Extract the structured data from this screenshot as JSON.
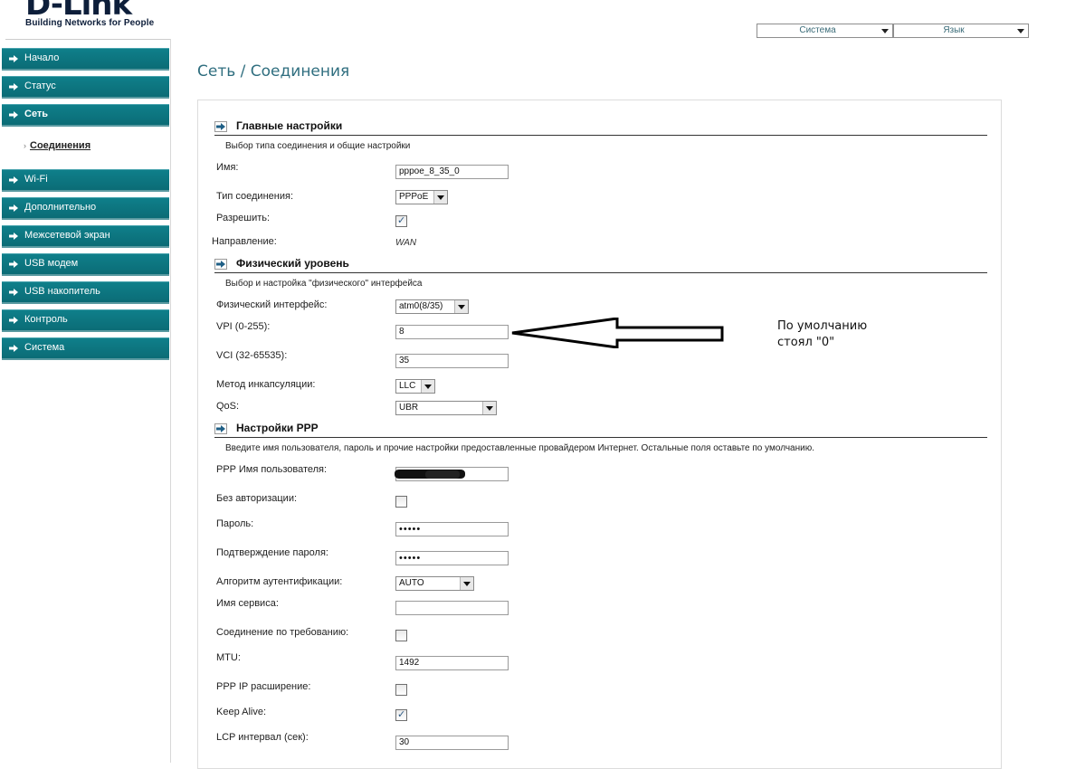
{
  "logo": {
    "name": "D-Link",
    "tagline": "Building Networks for People"
  },
  "top_menu": {
    "system": "Система",
    "language": "Язык"
  },
  "sidebar": {
    "items": [
      {
        "label": "Начало",
        "bold": false
      },
      {
        "label": "Статус",
        "bold": false
      },
      {
        "label": "Сеть",
        "bold": true
      },
      {
        "label": "Wi-Fi",
        "bold": false
      },
      {
        "label": "Дополнительно",
        "bold": false
      },
      {
        "label": "Межсетевой экран",
        "bold": false
      },
      {
        "label": "USB модем",
        "bold": false
      },
      {
        "label": "USB накопитель",
        "bold": false
      },
      {
        "label": "Контроль",
        "bold": false
      },
      {
        "label": "Система",
        "bold": false
      }
    ],
    "sub_item": "Соединения"
  },
  "page_title": "Сеть /  Соединения",
  "sections": {
    "main": {
      "title": "Главные настройки",
      "desc": "Выбор типа соединения и общие настройки",
      "name_label": "Имя:",
      "name_value": "pppoe_8_35_0",
      "type_label": "Тип соединения:",
      "type_value": "PPPoE",
      "enable_label": "Разрешить:",
      "enable_checked": true,
      "direction_label": "Направление:",
      "direction_value": "WAN"
    },
    "phys": {
      "title": "Физический уровень",
      "desc": "Выбор и настройка \"физического\" интерфейса",
      "iface_label": "Физический интерфейс:",
      "iface_value": "atm0(8/35)",
      "vpi_label": "VPI (0-255):",
      "vpi_value": "8",
      "vci_label": "VCI (32-65535):",
      "vci_value": "35",
      "encap_label": "Метод инкапсуляции:",
      "encap_value": "LLC",
      "qos_label": "QoS:",
      "qos_value": "UBR"
    },
    "ppp": {
      "title": "Настройки PPP",
      "desc": "Введите имя пользователя, пароль и прочие настройки предоставленные провайдером Интернет. Остальные поля оставьте по умолчанию.",
      "user_label": "PPP Имя пользователя:",
      "noauth_label": "Без авторизации:",
      "noauth_checked": false,
      "pass_label": "Пароль:",
      "pass_value": "•••••",
      "pass2_label": "Подтверждение пароля:",
      "pass2_value": "•••••",
      "auth_label": "Алгоритм аутентификации:",
      "auth_value": "AUTO",
      "service_label": "Имя сервиса:",
      "service_value": "",
      "ondemand_label": "Соединение по требованию:",
      "ondemand_checked": false,
      "mtu_label": "MTU:",
      "mtu_value": "1492",
      "ipext_label": "PPP IP расширение:",
      "ipext_checked": false,
      "keepalive_label": "Keep Alive:",
      "keepalive_checked": true,
      "lcp_label": "LCP интервал (сек):",
      "lcp_value": "30"
    }
  },
  "annotation": {
    "line1": "По умолчанию",
    "line2": "стоял \"0\""
  },
  "colors": {
    "nav_bg": "#0b6c76",
    "title": "#2f6e7f",
    "checkmark": "#2e5b86"
  }
}
